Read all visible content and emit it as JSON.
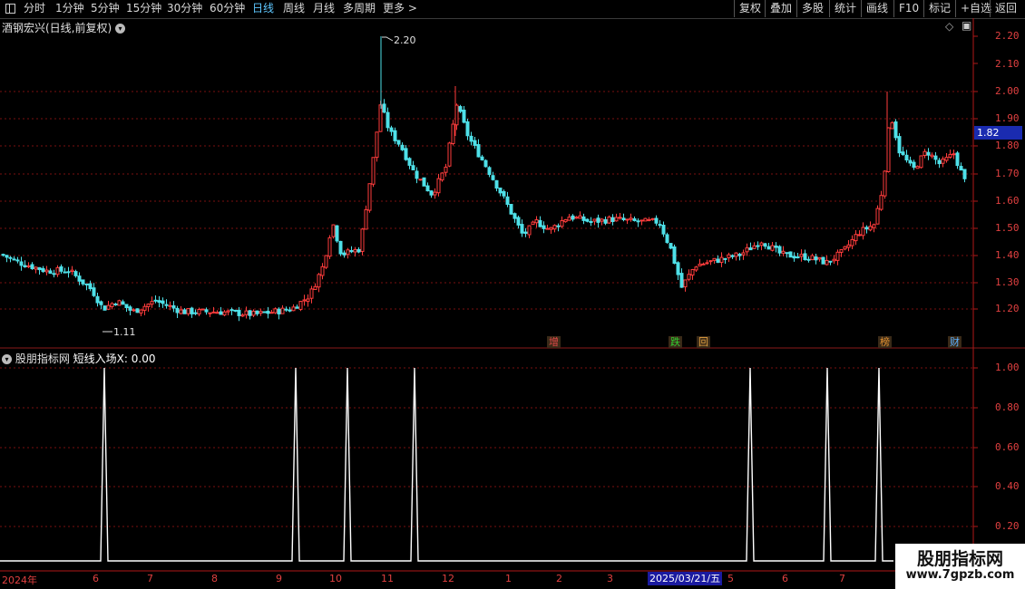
{
  "toolbar": {
    "periods": [
      "分时",
      "1分钟",
      "5分钟",
      "15分钟",
      "30分钟",
      "60分钟",
      "日线",
      "周线",
      "月线",
      "多周期",
      "更多 >"
    ],
    "active_period": "日线",
    "right_buttons": [
      "复权",
      "叠加",
      "多股",
      "统计",
      "画线",
      "F10",
      "标记",
      "+自选",
      "返回"
    ]
  },
  "main_chart": {
    "title": "酒钢宏兴(日线,前复权)",
    "high_label": "2.20",
    "low_label": "1.11",
    "current_price": "1.82",
    "price_ticks": [
      "2.20",
      "2.10",
      "2.00",
      "1.90",
      "1.80",
      "1.70",
      "1.60",
      "1.50",
      "1.40",
      "1.30",
      "1.20"
    ],
    "event_tags": [
      {
        "text": "增",
        "color": "#e04848"
      },
      {
        "text": "跌",
        "color": "#30d030"
      },
      {
        "text": "回",
        "color": "#e0a040"
      },
      {
        "text": "榜",
        "color": "#e09030"
      },
      {
        "text": "财",
        "color": "#5ab0ff"
      }
    ]
  },
  "indicator": {
    "site": "股朋指标网",
    "name": "短线入场X:",
    "value": "0.00",
    "ticks": [
      "1.00",
      "0.80",
      "0.60",
      "0.40",
      "0.20"
    ]
  },
  "date_axis": {
    "labels": [
      "2024年",
      "6",
      "7",
      "8",
      "9",
      "10",
      "11",
      "12",
      "1",
      "2",
      "3",
      "5",
      "6",
      "7"
    ],
    "highlight": "2025/03/21/五"
  },
  "watermark": {
    "title": "股朋指标网",
    "url": "www.7gpzb.com"
  },
  "colors": {
    "up": "#ff3c3c",
    "down": "#4ee0e8",
    "grid": "#7a1010",
    "axis": "#b01818",
    "signal": "#ffffff"
  }
}
